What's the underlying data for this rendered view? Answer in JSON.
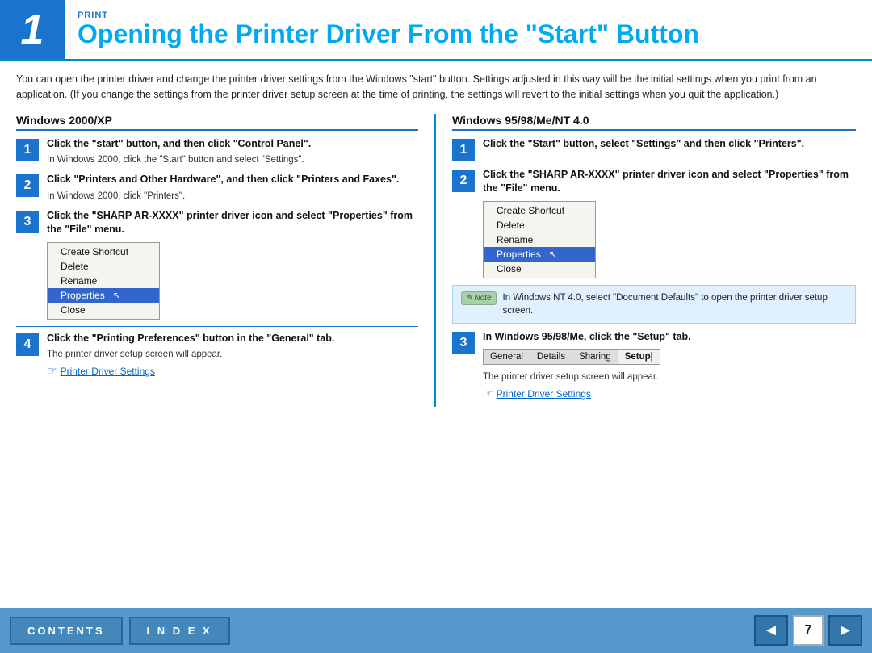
{
  "header": {
    "number": "1",
    "label": "PRINT",
    "title": "Opening the Printer Driver From the \"Start\" Button"
  },
  "intro": "You can open the printer driver and change the printer driver settings from the Windows \"start\" button. Settings adjusted in this way will be the initial settings when you print from an application. (If you change the settings from the printer driver setup screen at the time of printing, the settings will revert to the initial settings when you quit the application.)",
  "left_column": {
    "heading": "Windows 2000/XP",
    "steps": [
      {
        "number": "1",
        "main": "Click the \"start\" button, and then click \"Control Panel\".",
        "sub": "In Windows 2000, click the \"Start\" button and select \"Settings\"."
      },
      {
        "number": "2",
        "main": "Click \"Printers and Other Hardware\", and then click \"Printers and Faxes\".",
        "sub": "In Windows 2000, click \"Printers\"."
      },
      {
        "number": "3",
        "main": "Click the \"SHARP AR-XXXX\" printer driver icon and select \"Properties\" from the \"File\" menu.",
        "sub": ""
      },
      {
        "number": "4",
        "main": "Click the \"Printing Preferences\" button in the \"General\" tab.",
        "sub": "The printer driver setup screen will appear."
      }
    ],
    "context_menu": {
      "items": [
        "Create Shortcut",
        "Delete",
        "Rename",
        "Properties",
        "Close"
      ],
      "selected": "Properties"
    },
    "link_label": "Printer Driver Settings"
  },
  "right_column": {
    "heading": "Windows 95/98/Me/NT 4.0",
    "steps": [
      {
        "number": "1",
        "main": "Click the \"Start\" button, select \"Settings\" and then click \"Printers\".",
        "sub": ""
      },
      {
        "number": "2",
        "main": "Click the \"SHARP AR-XXXX\" printer driver icon and select \"Properties\" from the \"File\" menu.",
        "sub": ""
      },
      {
        "number": "3",
        "main": "In Windows 95/98/Me, click the \"Setup\" tab.",
        "sub": "The printer driver setup screen will appear."
      }
    ],
    "context_menu": {
      "items": [
        "Create Shortcut",
        "Delete",
        "Rename",
        "Properties",
        "Close"
      ],
      "selected": "Properties"
    },
    "note_text": "In Windows NT 4.0, select \"Document Defaults\" to open the printer driver setup screen.",
    "note_label": "Note",
    "tab_items": [
      "General",
      "Details",
      "Sharing",
      "Setup"
    ],
    "active_tab": "Setup",
    "link_label": "Printer Driver Settings"
  },
  "footer": {
    "contents_label": "CONTENTS",
    "index_label": "I N D E X",
    "page_number": "7",
    "prev_arrow": "◄",
    "next_arrow": "►"
  }
}
